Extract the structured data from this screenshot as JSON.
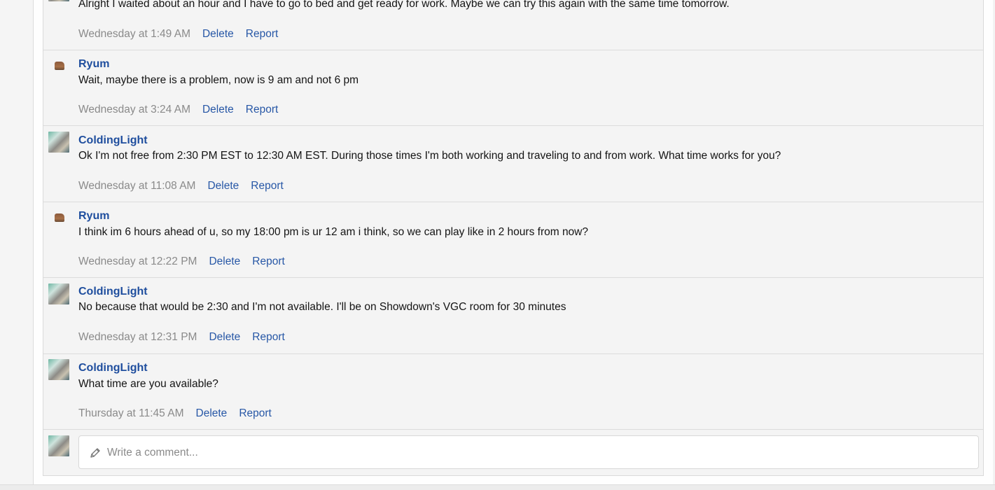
{
  "comments": [
    {
      "author": "",
      "avatar": "coldinglight-avatar",
      "text": "Alright I waited about an hour and I have to go to bed and get ready for work. Maybe we can try this again with the same time tomorrow.",
      "timestamp": "Wednesday at 1:49 AM",
      "delete_label": "Delete",
      "report_label": "Report"
    },
    {
      "author": "Ryum",
      "avatar": "ryum-avatar",
      "text": "Wait, maybe there is a problem, now is 9 am and not 6 pm",
      "timestamp": "Wednesday at 3:24 AM",
      "delete_label": "Delete",
      "report_label": "Report"
    },
    {
      "author": "ColdingLight",
      "avatar": "coldinglight-avatar",
      "text": "Ok I'm not free from 2:30 PM EST to 12:30 AM EST. During those times I'm both working and traveling to and from work. What time works for you?",
      "timestamp": "Wednesday at 11:08 AM",
      "delete_label": "Delete",
      "report_label": "Report"
    },
    {
      "author": "Ryum",
      "avatar": "ryum-avatar",
      "text": "I think im 6 hours ahead of u, so my 18:00 pm is ur 12 am i think, so we can play like in 2 hours from now?",
      "timestamp": "Wednesday at 12:22 PM",
      "delete_label": "Delete",
      "report_label": "Report"
    },
    {
      "author": "ColdingLight",
      "avatar": "coldinglight-avatar",
      "text": "No because that would be 2:30 and I'm not available. I'll be on Showdown's VGC room for 30 minutes",
      "timestamp": "Wednesday at 12:31 PM",
      "delete_label": "Delete",
      "report_label": "Report"
    },
    {
      "author": "ColdingLight",
      "avatar": "coldinglight-avatar",
      "text": "What time are you available?",
      "timestamp": "Thursday at 11:45 AM",
      "delete_label": "Delete",
      "report_label": "Report"
    }
  ],
  "composer": {
    "placeholder": "Write a comment...",
    "icon": "pencil-icon"
  },
  "colors": {
    "author_link": "#1f4e9e",
    "action_link": "#2757a6",
    "meta_text": "#8a8a8a",
    "comment_bg": "#f4f4f4"
  }
}
